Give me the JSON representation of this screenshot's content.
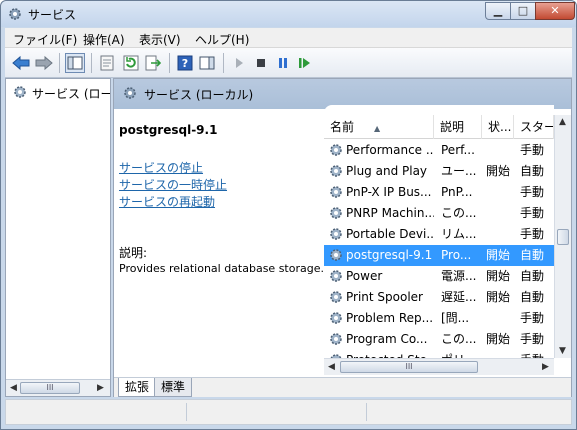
{
  "window": {
    "title": "サービス"
  },
  "menu": [
    "ファイル(F)",
    "操作(A)",
    "表示(V)",
    "ヘルプ(H)"
  ],
  "toolbar": {
    "icons": [
      "back-arrow-icon",
      "forward-arrow-icon",
      "show-hide-tree-icon",
      "properties-icon",
      "refresh-icon",
      "export-list-icon",
      "help-icon",
      "action-pane-icon",
      "start-service-icon",
      "stop-service-icon",
      "pause-service-icon",
      "restart-service-icon"
    ]
  },
  "tree": {
    "selected_label": "サービス (ロー"
  },
  "pane_header": {
    "title": "サービス (ローカル)"
  },
  "details": {
    "service_name": "postgresql-9.1",
    "links": [
      "サービスの停止",
      "サービスの一時停止",
      "サービスの再起動"
    ],
    "description_label": "説明:",
    "description_text": "Provides relational database storage."
  },
  "list": {
    "columns": [
      "名前",
      "説明",
      "状...",
      "スター"
    ],
    "rows": [
      {
        "name": "Performance ...",
        "desc": "Perf...",
        "status": "",
        "startup": "手動",
        "selected": false
      },
      {
        "name": "Plug and Play",
        "desc": "ユー...",
        "status": "開始",
        "startup": "自動",
        "selected": false
      },
      {
        "name": "PnP-X IP Bus...",
        "desc": "PnP...",
        "status": "",
        "startup": "手動",
        "selected": false
      },
      {
        "name": "PNRP Machin...",
        "desc": "この...",
        "status": "",
        "startup": "手動",
        "selected": false
      },
      {
        "name": "Portable Devi...",
        "desc": "リム...",
        "status": "",
        "startup": "手動",
        "selected": false
      },
      {
        "name": "postgresql-9.1",
        "desc": "Pro...",
        "status": "開始",
        "startup": "自動",
        "selected": true
      },
      {
        "name": "Power",
        "desc": "電源...",
        "status": "開始",
        "startup": "自動",
        "selected": false
      },
      {
        "name": "Print Spooler",
        "desc": "遅延...",
        "status": "開始",
        "startup": "自動",
        "selected": false
      },
      {
        "name": "Problem Rep...",
        "desc": "[問...",
        "status": "",
        "startup": "手動",
        "selected": false
      },
      {
        "name": "Program Co...",
        "desc": "この...",
        "status": "開始",
        "startup": "手動",
        "selected": false
      },
      {
        "name": "Protected Sto...",
        "desc": "ポリ...",
        "status": "",
        "startup": "手動",
        "selected": false
      }
    ]
  },
  "tabs": [
    "拡張",
    "標準"
  ],
  "colors": {
    "selection": "#3399ff",
    "link": "#1e66aa",
    "header_band": "#b8c9df"
  }
}
